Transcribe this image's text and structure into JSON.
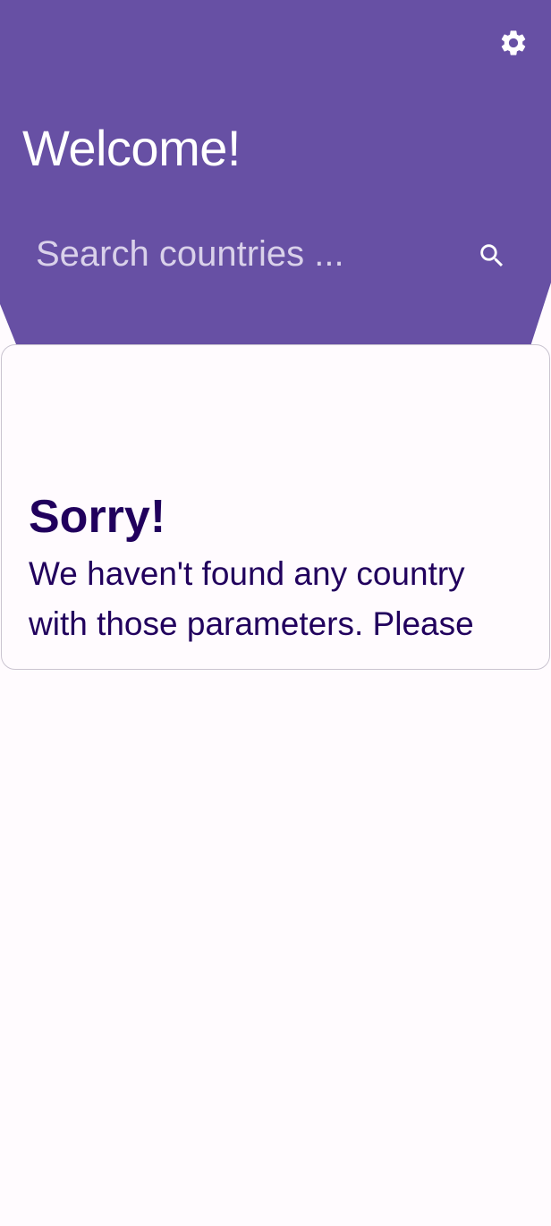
{
  "header": {
    "title": "Welcome!",
    "settings_icon": "gear-icon",
    "search": {
      "placeholder": "Search countries ...",
      "value": "",
      "icon": "search-icon"
    }
  },
  "empty_state": {
    "title": "Sorry!",
    "message": "We haven't found any country with those parameters. Please"
  },
  "colors": {
    "primary": "#6750a4",
    "on_primary": "#ffffff",
    "placeholder": "#d9d1ea",
    "background": "#fffbfe",
    "card_border": "#cac4d0",
    "text_dark": "#21005d"
  }
}
